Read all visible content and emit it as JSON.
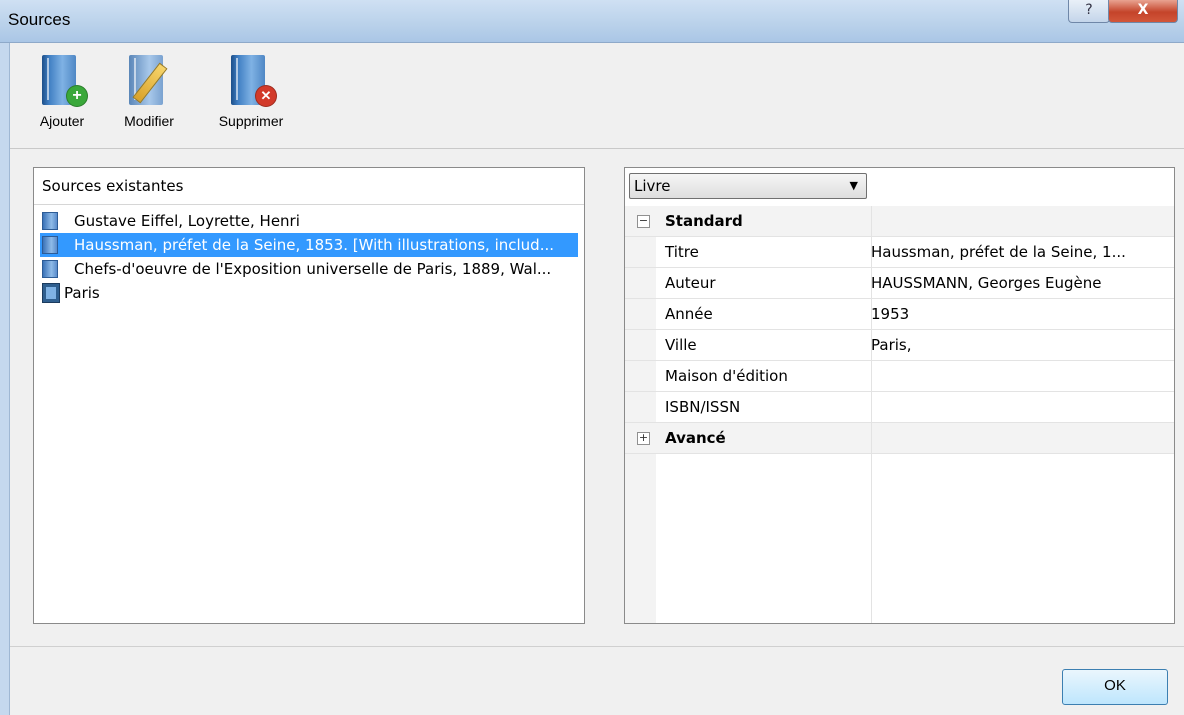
{
  "window": {
    "title": "Sources",
    "help_label": "?",
    "close_label": "X"
  },
  "toolbar": {
    "add_label": "Ajouter",
    "edit_label": "Modifier",
    "delete_label": "Supprimer"
  },
  "sources": {
    "header": "Sources existantes",
    "items": [
      {
        "label": "Gustave Eiffel, Loyrette, Henri",
        "icon": "book-icon"
      },
      {
        "label": "Haussman, préfet de la Seine, 1853. [With illustrations, includ...",
        "icon": "book-icon"
      },
      {
        "label": "Chefs-d'oeuvre de l'Exposition universelle de Paris, 1889, Wal...",
        "icon": "book-icon"
      },
      {
        "label": "Paris",
        "icon": "film-icon"
      }
    ]
  },
  "details": {
    "type_select": "Livre",
    "standard_label": "Standard",
    "advanced_label": "Avancé",
    "rows": [
      {
        "key": "Titre",
        "value": "Haussman, préfet de la Seine, 1..."
      },
      {
        "key": "Auteur",
        "value": "HAUSSMANN, Georges Eugène"
      },
      {
        "key": "Année",
        "value": "1953"
      },
      {
        "key": "Ville",
        "value": "Paris,"
      },
      {
        "key": "Maison d'édition",
        "value": ""
      },
      {
        "key": "ISBN/ISSN",
        "value": ""
      }
    ]
  },
  "footer": {
    "ok_label": "OK"
  },
  "colors": {
    "selection": "#3399ff",
    "titlebar": "#b9d1ea"
  }
}
